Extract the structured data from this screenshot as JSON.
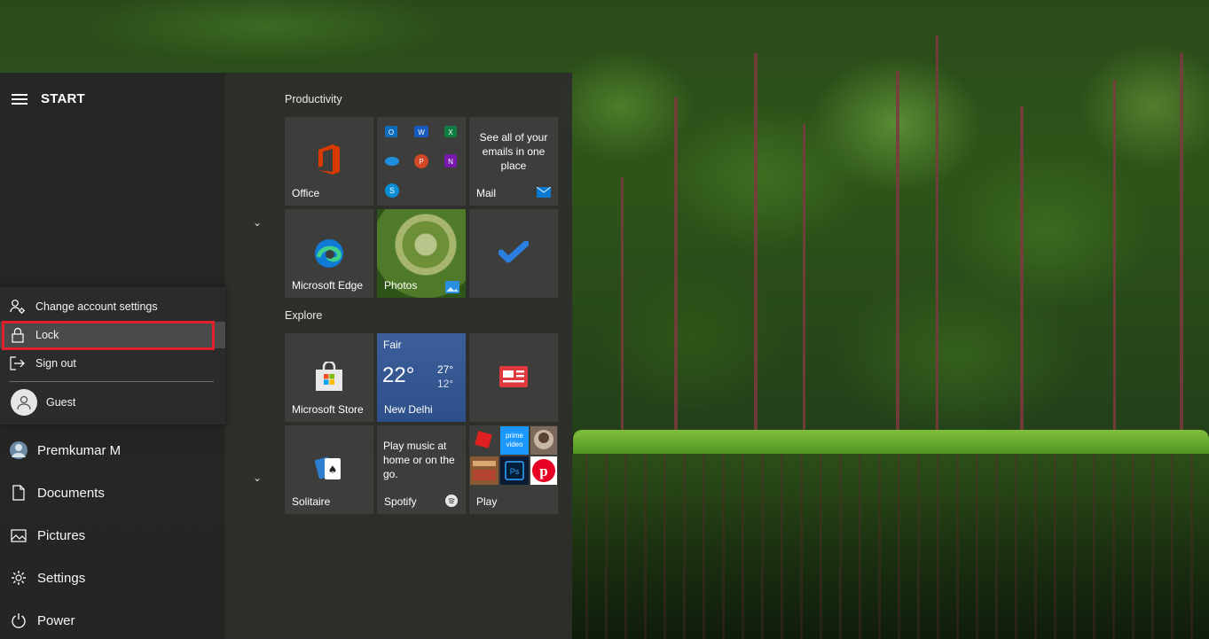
{
  "start_menu": {
    "title": "START",
    "account_flyout": {
      "items": [
        {
          "label": "Change account settings",
          "icon": "account-settings-icon"
        },
        {
          "label": "Lock",
          "icon": "lock-icon"
        },
        {
          "label": "Sign out",
          "icon": "sign-out-icon"
        }
      ],
      "user": "Guest"
    },
    "rail": [
      {
        "label": "Premkumar M",
        "icon": "user-avatar-icon"
      },
      {
        "label": "Documents",
        "icon": "document-icon"
      },
      {
        "label": "Pictures",
        "icon": "pictures-icon"
      },
      {
        "label": "Settings",
        "icon": "gear-icon"
      },
      {
        "label": "Power",
        "icon": "power-icon"
      }
    ],
    "groups": {
      "productivity": "Productivity",
      "explore": "Explore"
    },
    "tiles": {
      "office": "Office",
      "mail_text": [
        "See all of your",
        "emails in one",
        "place"
      ],
      "mail": "Mail",
      "edge": "Microsoft Edge",
      "photos": "Photos",
      "store": "Microsoft Store",
      "weather": {
        "condition": "Fair",
        "temp": "22°",
        "high": "27°",
        "low": "12°",
        "city": "New Delhi"
      },
      "solitaire": "Solitaire",
      "spotify_text": [
        "Play music at",
        "home or on the",
        "go."
      ],
      "spotify": "Spotify",
      "play": "Play"
    }
  },
  "colors": {
    "highlight": "#e0202a",
    "office": "#d83b01",
    "edge": "#0f7bd6",
    "mail": "#0b78d0"
  }
}
